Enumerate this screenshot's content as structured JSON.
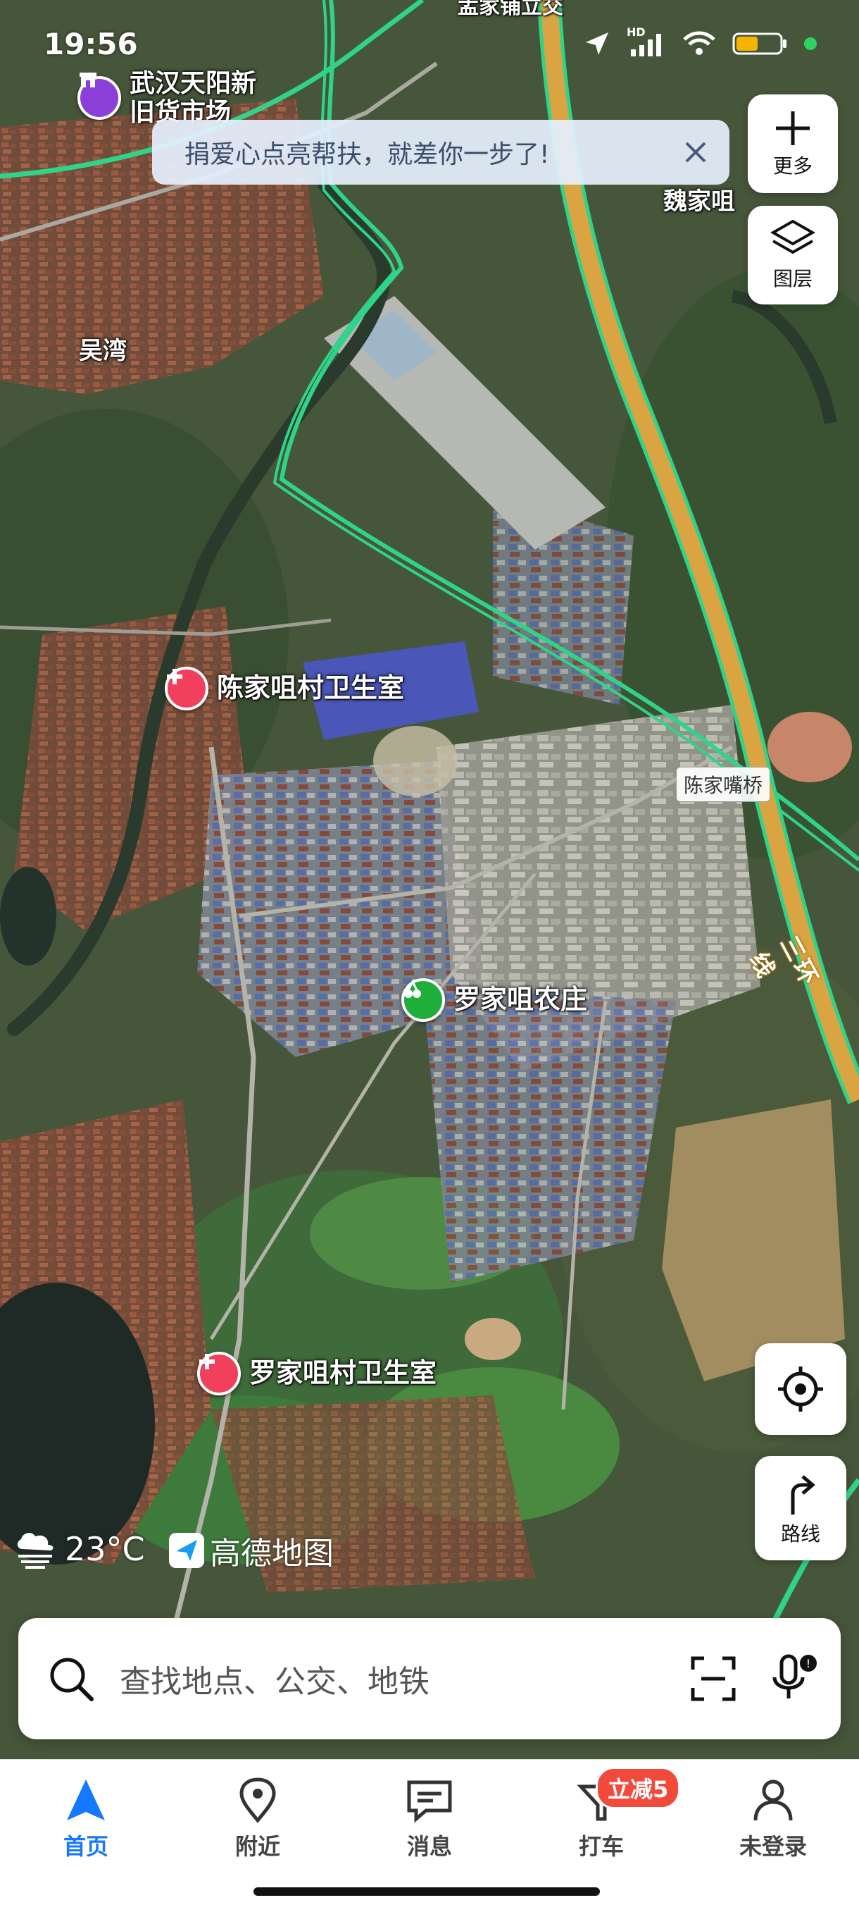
{
  "status_bar": {
    "time": "19:56",
    "network_label": "HD"
  },
  "banner": {
    "message": "捐爱心点亮帮扶，就差你一步了!"
  },
  "map": {
    "place_labels": [
      "吴湾",
      "魏家咀",
      "盂家铺立交"
    ],
    "road_tags": [
      "陈家嘴桥"
    ],
    "ring_road": "三环线",
    "pois": [
      {
        "name": "武汉天阳新\n旧货市场",
        "kind": "market",
        "color": "purple"
      },
      {
        "name": "陈家咀村卫生室",
        "kind": "clinic",
        "color": "red"
      },
      {
        "name": "罗家咀农庄",
        "kind": "farm",
        "color": "green"
      },
      {
        "name": "罗家咀村卫生室",
        "kind": "clinic",
        "color": "red"
      }
    ]
  },
  "side_buttons": {
    "more_label": "更多",
    "layers_label": "图层",
    "route_label": "路线"
  },
  "weather": {
    "temperature": "23°C",
    "icon": "cloud-fog-icon"
  },
  "brand": {
    "name": "高德地图"
  },
  "search": {
    "placeholder": "查找地点、公交、地铁"
  },
  "bottom_nav": {
    "items": [
      {
        "label": "首页",
        "icon": "navigation-arrow-icon",
        "active": true
      },
      {
        "label": "附近",
        "icon": "location-pin-icon",
        "active": false
      },
      {
        "label": "消息",
        "icon": "message-icon",
        "active": false
      },
      {
        "label": "打车",
        "icon": "taxi-icon",
        "active": false
      },
      {
        "label": "未登录",
        "icon": "user-icon",
        "active": false
      }
    ],
    "promo_badge": "立减5"
  },
  "colors": {
    "accent": "#1677ff",
    "route_green": "#2fd48a",
    "ring_road": "#d9a441",
    "promo": "#f24a3a"
  }
}
